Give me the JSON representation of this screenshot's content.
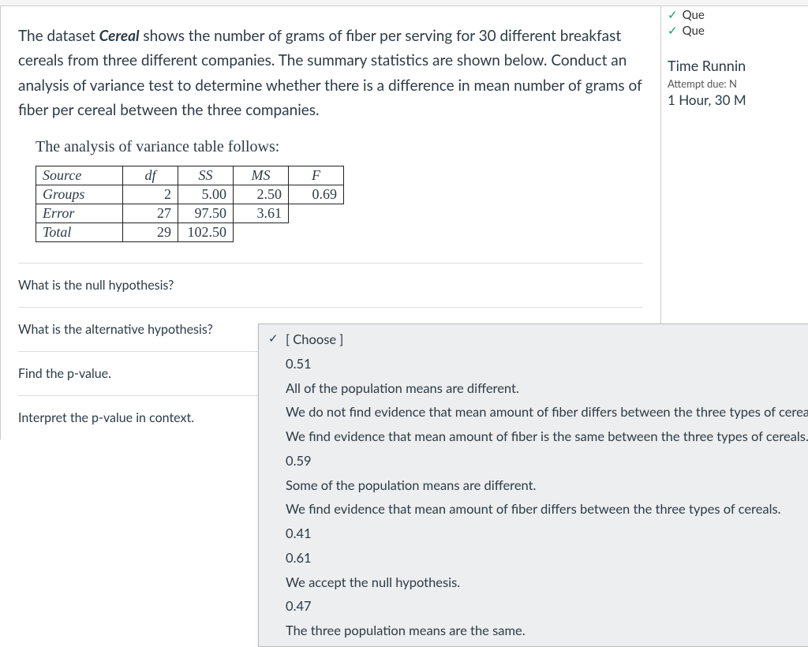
{
  "sidebar": {
    "items": [
      {
        "label": "Que"
      },
      {
        "label": "Que"
      }
    ],
    "timeRunningLabel": "Time Runnin",
    "attemptDue": "Attempt due: N",
    "timeLeft": "1 Hour, 30 M"
  },
  "question": {
    "intro_parts": {
      "pre": "The dataset ",
      "dataset": "Cereal",
      "post": " shows the number of grams of fiber per serving for 30 different breakfast cereals from three different companies.  The summary statistics are shown below.  Conduct an analysis of variance test to determine whether there is a difference in mean number of grams of fiber per cereal between the three companies."
    },
    "anova_caption": "The analysis of variance table follows:",
    "anova": {
      "headers": [
        "Source",
        "df",
        "SS",
        "MS",
        "F"
      ],
      "rows": [
        {
          "source": "Groups",
          "df": "2",
          "ss": "5.00",
          "ms": "2.50",
          "f": "0.69"
        },
        {
          "source": "Error",
          "df": "27",
          "ss": "97.50",
          "ms": "3.61",
          "f": ""
        },
        {
          "source": "Total",
          "df": "29",
          "ss": "102.50",
          "ms": "",
          "f": ""
        }
      ]
    },
    "prompts": [
      "What is the null hypothesis?",
      "What is the alternative hypothesis?",
      "Find the p-value.",
      "Interpret the p-value in context."
    ]
  },
  "dropdown": {
    "selected": "[ Choose ]",
    "options": [
      "0.51",
      "All of the population means are different.",
      "We do not find evidence that mean amount of fiber differs between the three types of cereals.",
      "We find evidence that mean amount of fiber is the same between the three types of cereals.",
      "0.59",
      "Some of the population means are different.",
      "We find evidence that mean amount of fiber differs between the three types of cereals.",
      "0.41",
      "0.61",
      "We accept the null hypothesis.",
      "0.47",
      "The three population means are the same."
    ]
  }
}
